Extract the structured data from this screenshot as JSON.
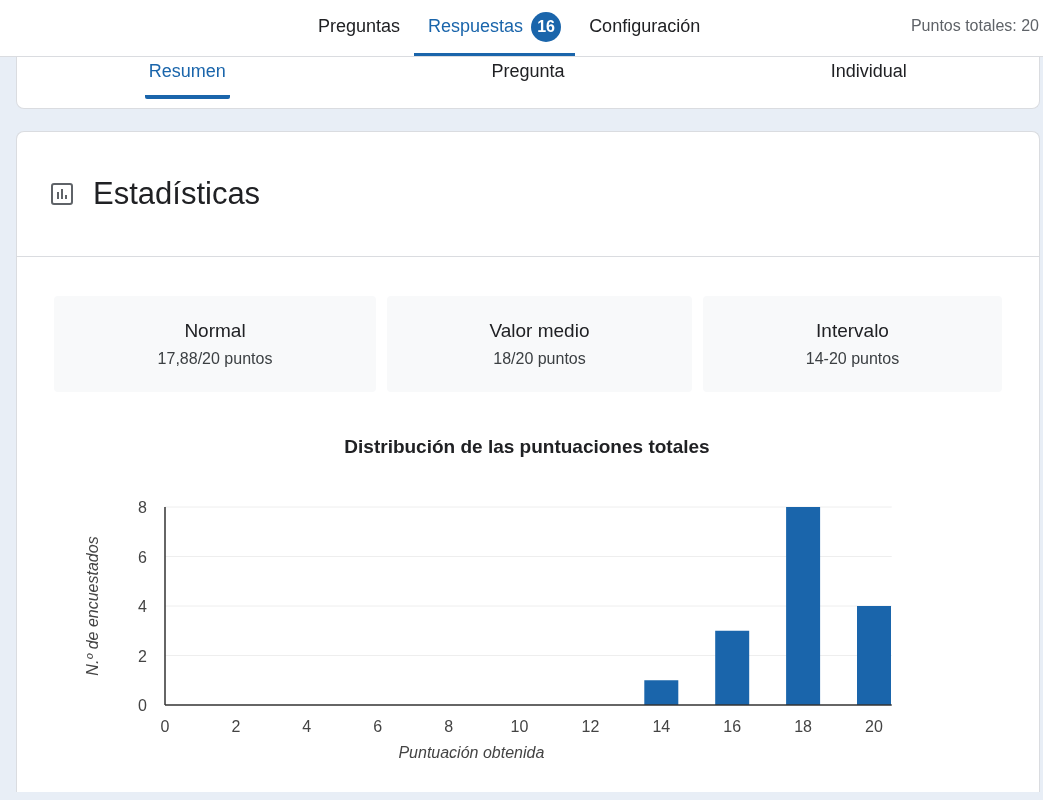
{
  "top_tabs": [
    {
      "label": "Preguntas",
      "selected": false
    },
    {
      "label": "Respuestas",
      "selected": true,
      "badge": "16"
    },
    {
      "label": "Configuración",
      "selected": false
    }
  ],
  "total_points": "Puntos totales: 20",
  "sub_tabs": [
    {
      "label": "Resumen",
      "selected": true
    },
    {
      "label": "Pregunta",
      "selected": false
    },
    {
      "label": "Individual",
      "selected": false
    }
  ],
  "section_title": "Estadísticas",
  "stats": [
    {
      "label": "Normal",
      "value": "17,88/20 puntos"
    },
    {
      "label": "Valor medio",
      "value": "18/20 puntos"
    },
    {
      "label": "Intervalo",
      "value": "14-20 puntos"
    }
  ],
  "chart": {
    "chart_data": {
      "type": "bar",
      "title": "Distribución de las puntuaciones totales",
      "xlabel": "Puntuación obtenida",
      "ylabel": "N.º de encuestados",
      "x": [
        14,
        16,
        18,
        20
      ],
      "series": [
        {
          "color": "#1a65ab",
          "values": [
            1,
            3,
            8,
            4
          ]
        }
      ],
      "grid": true,
      "xlim": [
        0,
        20.5
      ],
      "ylim": [
        0,
        8
      ],
      "xticks": [
        0,
        2,
        4,
        6,
        8,
        10,
        12,
        14,
        16,
        18,
        20
      ],
      "yticks": [
        0,
        2,
        4,
        6,
        8
      ]
    }
  }
}
